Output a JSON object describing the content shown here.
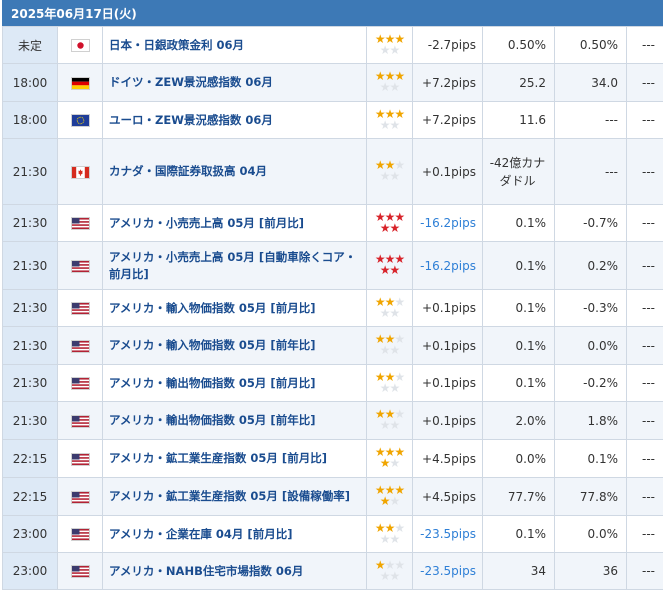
{
  "date_header": "2025年06月17日(火)",
  "colors": {
    "header_bg": "#3d79b6",
    "time_bg": "#dde9f6",
    "indicator_text": "#1a4c8f",
    "negative_pips": "#2e7fd6",
    "star_gold": "#f0a500",
    "star_red": "#d8232a"
  },
  "rows": [
    {
      "time": "未定",
      "flag": "jp-flag",
      "indicator": "日本・日銀政策金利 06月",
      "stars": 3,
      "star_color": "gold",
      "pips": "-2.7pips",
      "pips_negative": false,
      "result": "0.50%",
      "forecast": "0.50%",
      "previous": "---"
    },
    {
      "time": "18:00",
      "flag": "de-flag",
      "indicator": "ドイツ・ZEW景況感指数 06月",
      "stars": 3,
      "star_color": "gold",
      "pips": "+7.2pips",
      "pips_negative": false,
      "result": "25.2",
      "forecast": "34.0",
      "previous": "---"
    },
    {
      "time": "18:00",
      "flag": "eu-flag",
      "indicator": "ユーロ・ZEW景況感指数 06月",
      "stars": 3,
      "star_color": "gold",
      "pips": "+7.2pips",
      "pips_negative": false,
      "result": "11.6",
      "forecast": "---",
      "previous": "---"
    },
    {
      "time": "21:30",
      "flag": "ca-flag",
      "indicator": "カナダ・国際証券取扱高 04月",
      "stars": 2,
      "star_color": "gold",
      "pips": "+0.1pips",
      "pips_negative": false,
      "result": "-42億カナダドル",
      "forecast": "---",
      "previous": "---"
    },
    {
      "time": "21:30",
      "flag": "us-flag",
      "indicator": "アメリカ・小売売上高 05月 [前月比]",
      "stars": 5,
      "star_color": "red",
      "pips": "-16.2pips",
      "pips_negative": true,
      "result": "0.1%",
      "forecast": "-0.7%",
      "previous": "---"
    },
    {
      "time": "21:30",
      "flag": "us-flag",
      "indicator": "アメリカ・小売売上高 05月 [自動車除くコア・前月比]",
      "stars": 5,
      "star_color": "red",
      "pips": "-16.2pips",
      "pips_negative": true,
      "result": "0.1%",
      "forecast": "0.2%",
      "previous": "---"
    },
    {
      "time": "21:30",
      "flag": "us-flag",
      "indicator": "アメリカ・輸入物価指数 05月 [前月比]",
      "stars": 2,
      "star_color": "gold",
      "pips": "+0.1pips",
      "pips_negative": false,
      "result": "0.1%",
      "forecast": "-0.3%",
      "previous": "---"
    },
    {
      "time": "21:30",
      "flag": "us-flag",
      "indicator": "アメリカ・輸入物価指数 05月 [前年比]",
      "stars": 2,
      "star_color": "gold",
      "pips": "+0.1pips",
      "pips_negative": false,
      "result": "0.1%",
      "forecast": "0.0%",
      "previous": "---"
    },
    {
      "time": "21:30",
      "flag": "us-flag",
      "indicator": "アメリカ・輸出物価指数 05月 [前月比]",
      "stars": 2,
      "star_color": "gold",
      "pips": "+0.1pips",
      "pips_negative": false,
      "result": "0.1%",
      "forecast": "-0.2%",
      "previous": "---"
    },
    {
      "time": "21:30",
      "flag": "us-flag",
      "indicator": "アメリカ・輸出物価指数 05月 [前年比]",
      "stars": 2,
      "star_color": "gold",
      "pips": "+0.1pips",
      "pips_negative": false,
      "result": "2.0%",
      "forecast": "1.8%",
      "previous": "---"
    },
    {
      "time": "22:15",
      "flag": "us-flag",
      "indicator": "アメリカ・鉱工業生産指数 05月 [前月比]",
      "stars": 4,
      "star_color": "gold",
      "pips": "+4.5pips",
      "pips_negative": false,
      "result": "0.0%",
      "forecast": "0.1%",
      "previous": "---"
    },
    {
      "time": "22:15",
      "flag": "us-flag",
      "indicator": "アメリカ・鉱工業生産指数 05月 [設備稼働率]",
      "stars": 4,
      "star_color": "gold",
      "pips": "+4.5pips",
      "pips_negative": false,
      "result": "77.7%",
      "forecast": "77.8%",
      "previous": "---"
    },
    {
      "time": "23:00",
      "flag": "us-flag",
      "indicator": "アメリカ・企業在庫 04月 [前月比]",
      "stars": 2,
      "star_color": "gold",
      "pips": "-23.5pips",
      "pips_negative": true,
      "result": "0.1%",
      "forecast": "0.0%",
      "previous": "---"
    },
    {
      "time": "23:00",
      "flag": "us-flag",
      "indicator": "アメリカ・NAHB住宅市場指数 06月",
      "stars": 1,
      "star_color": "gold",
      "pips": "-23.5pips",
      "pips_negative": true,
      "result": "34",
      "forecast": "36",
      "previous": "---"
    }
  ]
}
